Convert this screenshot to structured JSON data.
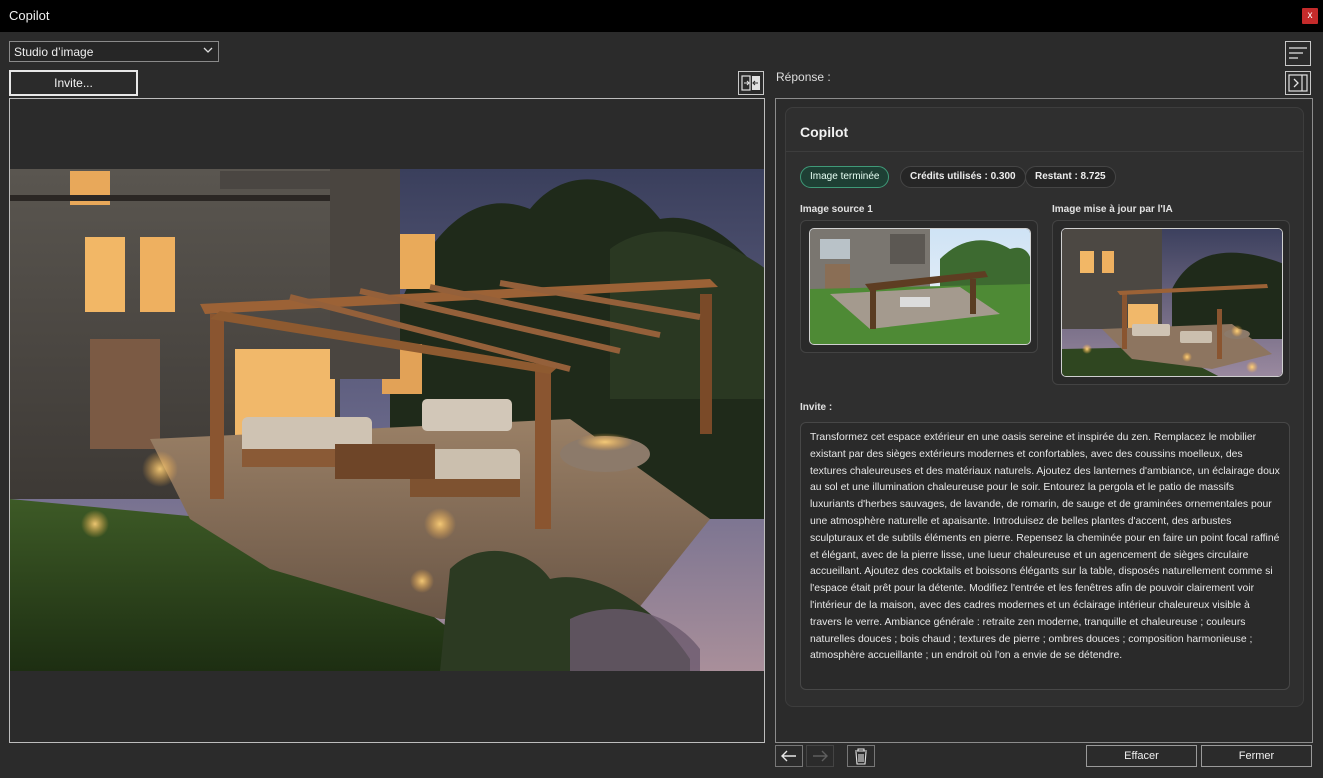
{
  "window": {
    "title": "Copilot",
    "close_label": "x"
  },
  "toolbar": {
    "mode_select": {
      "value": "Studio d’image"
    },
    "invite_button": "Invite...",
    "response_label": "Réponse :"
  },
  "response": {
    "card_title": "Copilot",
    "badges": {
      "status": "Image terminée",
      "credits": "Crédits utilisés : 0.300",
      "remaining": "Restant : 8.725"
    },
    "source_label": "Image source 1",
    "updated_label": "Image mise à jour par l'IA",
    "prompt_label": "Invite :",
    "prompt_text": "Transformez cet espace extérieur en une oasis sereine et inspirée du zen. Remplacez le mobilier existant par des sièges extérieurs modernes et confortables, avec des coussins moelleux, des textures chaleureuses et des matériaux naturels. Ajoutez des lanternes d'ambiance, un éclairage doux au sol et une illumination chaleureuse pour le soir. Entourez la pergola et le patio de massifs luxuriants d'herbes sauvages, de lavande, de romarin, de sauge et de graminées ornementales pour une atmosphère naturelle et apaisante. Introduisez de belles plantes d'accent, des arbustes sculpturaux et de subtils éléments en pierre. Repensez la cheminée pour en faire un point focal raffiné et élégant, avec de la pierre lisse, une lueur chaleureuse et un agencement de sièges circulaire accueillant. Ajoutez des cocktails et boissons élégants sur la table, disposés naturellement comme si l'espace était prêt pour la détente. Modifiez l'entrée et les fenêtres afin de pouvoir clairement voir l'intérieur de la maison, avec des cadres modernes et un éclairage intérieur chaleureux visible à travers le verre. Ambiance générale : retraite zen moderne, tranquille et chaleureuse ; couleurs naturelles douces ; bois chaud ; textures de pierre ; ombres douces ; composition harmonieuse ; atmosphère accueillante ; un endroit où l'on a envie de se détendre."
  },
  "footer": {
    "clear_button": "Effacer",
    "close_button": "Fermer"
  },
  "colors": {
    "accent_green": "#3f9a78",
    "close_red": "#c42b2b",
    "background": "#2b2b2b"
  },
  "icons": [
    "chevron-down-icon",
    "swap-panels-icon",
    "menu-lines-icon",
    "collapse-panel-icon",
    "arrow-left-icon",
    "arrow-right-icon",
    "trash-icon"
  ]
}
